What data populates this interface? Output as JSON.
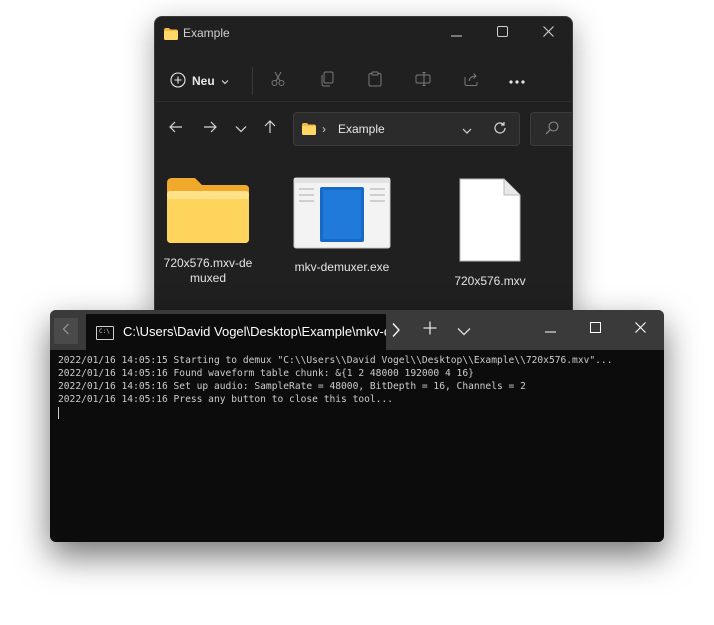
{
  "explorer": {
    "title": "Example",
    "toolbar": {
      "new_label": "Neu",
      "icons": [
        "cut-icon",
        "copy-icon",
        "paste-icon",
        "rename-icon",
        "share-icon",
        "more-icon"
      ]
    },
    "address": {
      "breadcrumb_separator": "›",
      "path": "Example"
    },
    "files": [
      {
        "name": "720x576.mxv-demuxed",
        "type": "folder"
      },
      {
        "name": "mkv-demuxer.exe",
        "type": "application"
      },
      {
        "name": "720x576.mxv",
        "type": "file"
      }
    ],
    "colors": {
      "background": "#202020",
      "folder": "#f7c948"
    }
  },
  "terminal": {
    "tab_title": "C:\\Users\\David Vogel\\Desktop\\Example\\mkv-demuxer.exe",
    "icon_text": "C:\\",
    "lines": [
      "2022/01/16 14:05:15 Starting to demux \"C:\\\\Users\\\\David Vogel\\\\Desktop\\\\Example\\\\720x576.mxv\"...",
      "2022/01/16 14:05:16 Found waveform table chunk: &{1 2 48000 192000 4 16}",
      "2022/01/16 14:05:16 Set up audio: SampleRate = 48000, BitDepth = 16, Channels = 2",
      "2022/01/16 14:05:16 Press any button to close this tool..."
    ],
    "colors": {
      "background": "#0c0c0c",
      "tabbar": "#3a3a3a",
      "text": "#cccccc"
    }
  }
}
